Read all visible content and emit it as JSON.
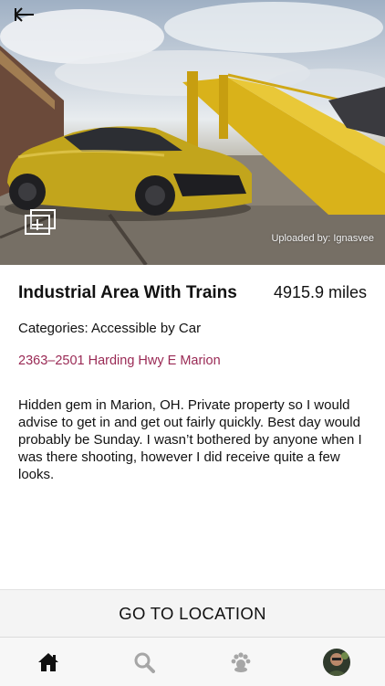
{
  "hero": {
    "uploader_text": "Uploaded by: Ignasvee"
  },
  "place": {
    "title": "Industrial Area With Trains",
    "distance": "4915.9 miles",
    "categories": "Categories: Accessible by Car",
    "address": "2363–2501 Harding Hwy E Marion",
    "description": "Hidden gem in Marion, OH. Private property so I would advise to get in and get out fairly quickly. Best day would probably be Sunday. I wasn’t bothered by anyone when I was there shooting, however I did receive quite a few looks."
  },
  "actions": {
    "go_to_location": "GO TO LOCATION"
  },
  "tabbar": {
    "tabs": [
      {
        "icon": "home-icon",
        "active": true
      },
      {
        "icon": "search-icon",
        "active": false
      },
      {
        "icon": "community-icon",
        "active": false
      },
      {
        "icon": "profile-avatar",
        "active": false
      }
    ]
  },
  "colors": {
    "address": "#9a2a55",
    "active_tab": "#111111",
    "inactive_tab": "#a6a6a6"
  }
}
